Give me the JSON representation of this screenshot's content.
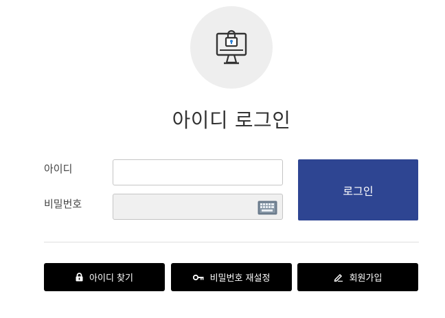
{
  "page_title": "아이디 로그인",
  "form": {
    "id_label": "아이디",
    "id_value": "",
    "password_label": "비밀번호",
    "password_value": "",
    "login_label": "로그인"
  },
  "actions": {
    "find_id": {
      "label": "아이디 찾기",
      "icon": "lock-icon"
    },
    "reset_password": {
      "label": "비밀번호 재설정",
      "icon": "key-icon"
    },
    "signup": {
      "label": "회원가입",
      "icon": "pen-icon"
    }
  },
  "colors": {
    "login_button": "#2e4592",
    "action_buttons": "#000000",
    "hero_background": "#eeeeee",
    "lock_accent": "#2a7fd4"
  }
}
